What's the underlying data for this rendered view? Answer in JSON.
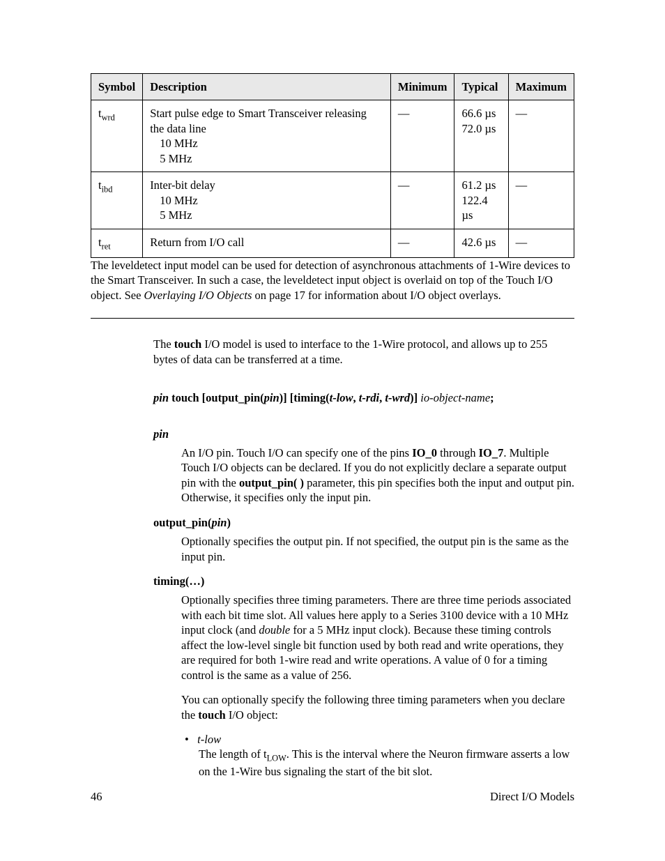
{
  "table": {
    "headers": {
      "c1": "Symbol",
      "c2": "Description",
      "c3": "Minimum",
      "c4": "Typical",
      "c5": "Maximum"
    },
    "rows": [
      {
        "sym_base": "t",
        "sym_sub": "wrd",
        "desc_lines": [
          "Start pulse edge to Smart Transceiver releasing the data line",
          "10 MHz",
          "5 MHz"
        ],
        "min": "—",
        "typ_lines": [
          "",
          "66.6 µs",
          "72.0 µs"
        ],
        "max": "—"
      },
      {
        "sym_base": "t",
        "sym_sub": "ibd",
        "desc_lines": [
          "Inter-bit delay",
          "10 MHz",
          "5 MHz"
        ],
        "min": "—",
        "typ_lines": [
          "",
          "61.2 µs",
          "122.4 µs"
        ],
        "max": "—"
      },
      {
        "sym_base": "t",
        "sym_sub": "ret",
        "desc_lines": [
          "Return from I/O call"
        ],
        "min": "—",
        "typ_lines": [
          "42.6 µs"
        ],
        "max": "—"
      }
    ]
  },
  "after_table": {
    "p1a": "The leveldetect input model can be used for detection of asynchronous attachments of 1-Wire devices to the Smart Transceiver.  In such a case, the leveldetect input object is overlaid on top of the Touch I/O object.  See ",
    "p1_link": "Overlaying I/O Objects",
    "p1b": " on page 17 for information about I/O object overlays."
  },
  "intro": {
    "p1a": "The ",
    "p1_b": "touch",
    "p1b": " I/O model is used to interface to the 1-Wire protocol, and allows up to 255 bytes of data can be transferred at a time."
  },
  "syntax": {
    "s1": "pin",
    "s2": " touch [output_pin(",
    "s3": "pin",
    "s4": ")] [timing(",
    "s5": "t-low",
    "s6": ", ",
    "s7": "t-rdi",
    "s8": ", ",
    "s9": "t-wrd",
    "s10": ")] ",
    "s11": "io-object-name",
    "s12": ";"
  },
  "params": {
    "pin": {
      "term": "pin",
      "d1": "An I/O pin.  Touch I/O can specify one of the pins ",
      "d2": "IO_0",
      "d3": " through ",
      "d4": "IO_7",
      "d5": ".  Multiple Touch I/O objects can be declared.  If you do not explicitly declare a separate output pin with the ",
      "d6": "output_pin( )",
      "d7": " parameter, this pin specifies both the input and output pin.  Otherwise, it specifies only the input pin."
    },
    "output_pin": {
      "term_a": "output_pin(",
      "term_i": "pin",
      "term_b": ")",
      "d": "Optionally specifies the output pin.  If not specified, the output pin is the same as the input pin."
    },
    "timing": {
      "term": "timing(…)",
      "d1a": "Optionally specifies three timing parameters.  There are three time periods associated with each bit time slot.  All values here apply to a Series 3100 device with a 10 MHz input clock (and ",
      "d1i": "double",
      "d1b": " for a 5 MHz input clock).  Because these timing controls affect the low-level single bit function used by both read and write operations, they are required for both 1-wire read and write operations.  A value of 0 for a timing control is the same as a value of 256.",
      "d2a": "You can optionally specify the following three timing parameters when you declare the ",
      "d2b": "touch",
      "d2c": " I/O object:",
      "bullet_label": "t-low",
      "bullet_body_a": "The length of t",
      "bullet_body_sub": "LOW",
      "bullet_body_b": ".  This is the interval where the Neuron firmware asserts a low on the 1-Wire bus signaling the start of the bit slot."
    }
  },
  "footer": {
    "left": "46",
    "right": "Direct I/O Models"
  }
}
